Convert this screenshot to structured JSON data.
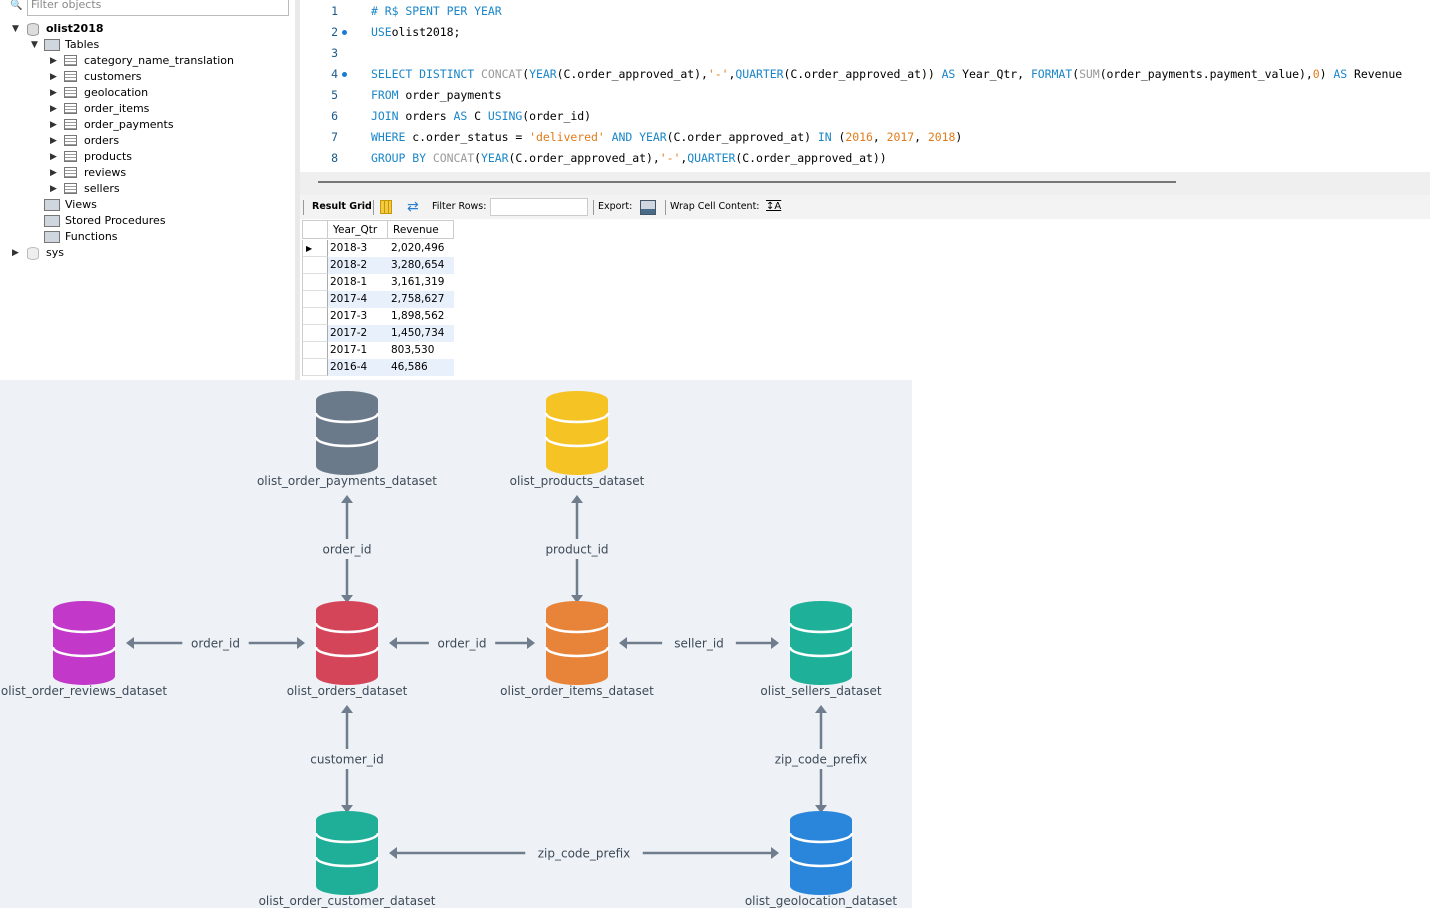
{
  "navigator": {
    "filter_placeholder": "Filter objects",
    "schema": "olist2018",
    "tables_label": "Tables",
    "tables": [
      "category_name_translation",
      "customers",
      "geolocation",
      "order_items",
      "order_payments",
      "orders",
      "products",
      "reviews",
      "sellers"
    ],
    "views": "Views",
    "procedures": "Stored Procedures",
    "functions": "Functions",
    "other_schema": "sys"
  },
  "editor": {
    "line_numbers": [
      "1",
      "2",
      "3",
      "4",
      "5",
      "6",
      "7",
      "8"
    ],
    "statement_dots": [
      2,
      4
    ],
    "lines": [
      [
        [
          "cm",
          "# R$ SPENT PER YEAR"
        ]
      ],
      [
        [
          "kw",
          "USE"
        ],
        [
          "",
          "olist2018;"
        ]
      ],
      [],
      [
        [
          "kw",
          "SELECT DISTINCT "
        ],
        [
          "fn",
          "CONCAT"
        ],
        [
          "",
          "("
        ],
        [
          "kw",
          "YEAR"
        ],
        [
          "",
          "(C.order_approved_at),"
        ],
        [
          "str",
          "'-'"
        ],
        [
          "",
          ","
        ],
        [
          "kw",
          "QUARTER"
        ],
        [
          "",
          "(C.order_approved_at)) "
        ],
        [
          "kw",
          "AS"
        ],
        [
          "",
          " Year_Qtr, "
        ],
        [
          "kw",
          "FORMAT"
        ],
        [
          "",
          "("
        ],
        [
          "fn",
          "SUM"
        ],
        [
          "",
          "(order_payments.payment_value),"
        ],
        [
          "num",
          "0"
        ],
        [
          "",
          ") "
        ],
        [
          "kw",
          "AS"
        ],
        [
          "",
          " Revenue"
        ]
      ],
      [
        [
          "kw",
          "FROM"
        ],
        [
          "",
          " order_payments"
        ]
      ],
      [
        [
          "kw",
          "JOIN"
        ],
        [
          "",
          " orders "
        ],
        [
          "kw",
          "AS"
        ],
        [
          "",
          " C "
        ],
        [
          "kw",
          "USING"
        ],
        [
          "",
          "(order_id)"
        ]
      ],
      [
        [
          "kw",
          "WHERE"
        ],
        [
          "",
          " c.order_status = "
        ],
        [
          "str",
          "'delivered'"
        ],
        [
          "",
          ""
        ],
        [
          "kw",
          " AND "
        ],
        [
          "kw",
          "YEAR"
        ],
        [
          "",
          "(C.order_approved_at) "
        ],
        [
          "kw",
          "IN"
        ],
        [
          "",
          " ("
        ],
        [
          "num",
          "2016"
        ],
        [
          "",
          ", "
        ],
        [
          "num",
          "2017"
        ],
        [
          "",
          ", "
        ],
        [
          "num",
          "2018"
        ],
        [
          "",
          ")"
        ]
      ],
      [
        [
          "kw",
          "GROUP BY "
        ],
        [
          "fn",
          "CONCAT"
        ],
        [
          "",
          "("
        ],
        [
          "kw",
          "YEAR"
        ],
        [
          "",
          "(C.order_approved_at),"
        ],
        [
          "str",
          "'-'"
        ],
        [
          "",
          ","
        ],
        [
          "kw",
          "QUARTER"
        ],
        [
          "",
          "(C.order_approved_at))"
        ]
      ]
    ]
  },
  "toolbar": {
    "result_grid": "Result Grid",
    "filter_rows": "Filter Rows:",
    "export": "Export:",
    "wrap": "Wrap Cell Content:"
  },
  "grid": {
    "columns": [
      "Year_Qtr",
      "Revenue"
    ],
    "rows": [
      [
        "2018-3",
        "2,020,496"
      ],
      [
        "2018-2",
        "3,280,654"
      ],
      [
        "2018-1",
        "3,161,319"
      ],
      [
        "2017-4",
        "2,758,627"
      ],
      [
        "2017-3",
        "1,898,562"
      ],
      [
        "2017-2",
        "1,450,734"
      ],
      [
        "2017-1",
        "803,530"
      ],
      [
        "2016-4",
        "46,586"
      ]
    ]
  },
  "diagram": {
    "nodes": [
      {
        "id": "payments",
        "label": "olist_order_payments_dataset",
        "color": "#6b7a8a"
      },
      {
        "id": "products",
        "label": "olist_products_dataset",
        "color": "#f5c324"
      },
      {
        "id": "reviews",
        "label": "olist_order_reviews_dataset",
        "color": "#c238c9"
      },
      {
        "id": "orders",
        "label": "olist_orders_dataset",
        "color": "#d5455a"
      },
      {
        "id": "items",
        "label": "olist_order_items_dataset",
        "color": "#e8843a"
      },
      {
        "id": "sellers",
        "label": "olist_sellers_dataset",
        "color": "#1fb09a"
      },
      {
        "id": "customers",
        "label": "olist_order_customer_dataset",
        "color": "#1fae98"
      },
      {
        "id": "geolocation",
        "label": "olist_geolocation_dataset",
        "color": "#2a86db"
      }
    ],
    "edges": [
      {
        "from": "payments",
        "to": "orders",
        "label": "order_id"
      },
      {
        "from": "products",
        "to": "items",
        "label": "product_id"
      },
      {
        "from": "reviews",
        "to": "orders",
        "label": "order_id"
      },
      {
        "from": "orders",
        "to": "items",
        "label": "order_id"
      },
      {
        "from": "items",
        "to": "sellers",
        "label": "seller_id"
      },
      {
        "from": "orders",
        "to": "customers",
        "label": "customer_id"
      },
      {
        "from": "sellers",
        "to": "geolocation",
        "label": "zip_code_prefix"
      },
      {
        "from": "customers",
        "to": "geolocation",
        "label": "zip_code_prefix"
      }
    ],
    "edge_color": "#6f7d8c"
  }
}
